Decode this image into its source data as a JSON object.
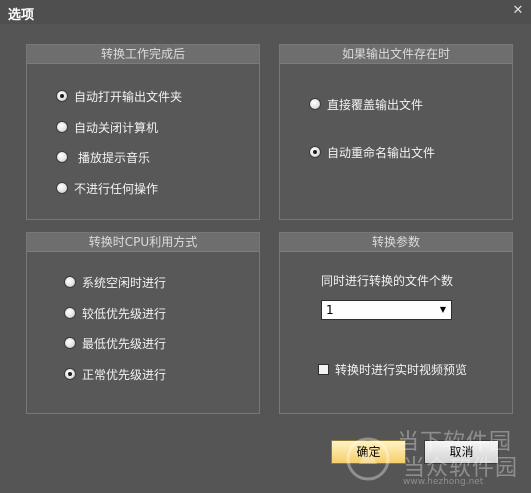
{
  "window": {
    "title": "选项",
    "close_glyph": "✕"
  },
  "completion_panel": {
    "title": "转换工作完成后",
    "options": [
      {
        "label": "自动打开输出文件夹",
        "checked": true
      },
      {
        "label": "自动关闭计算机",
        "checked": false
      },
      {
        "label": "播放提示音乐",
        "checked": false
      },
      {
        "label": "不进行任何操作",
        "checked": false
      }
    ]
  },
  "exists_panel": {
    "title": "如果输出文件存在时",
    "options": [
      {
        "label": "直接覆盖输出文件",
        "checked": false
      },
      {
        "label": "自动重命名输出文件",
        "checked": true
      }
    ]
  },
  "cpu_panel": {
    "title": "转换时CPU利用方式",
    "options": [
      {
        "label": "系统空闲时进行",
        "checked": false
      },
      {
        "label": "较低优先级进行",
        "checked": false
      },
      {
        "label": "最低优先级进行",
        "checked": false
      },
      {
        "label": "正常优先级进行",
        "checked": true
      }
    ]
  },
  "params_panel": {
    "title": "转换参数",
    "concurrent_label": "同时进行转换的文件个数",
    "concurrent_value": "1",
    "preview_label": "转换时进行实时视频预览",
    "preview_checked": false
  },
  "buttons": {
    "ok": "确定",
    "cancel": "取消"
  },
  "watermark": {
    "line1": "当下软件园",
    "line2": "当众软件园",
    "url": "www.hezhong.net"
  }
}
